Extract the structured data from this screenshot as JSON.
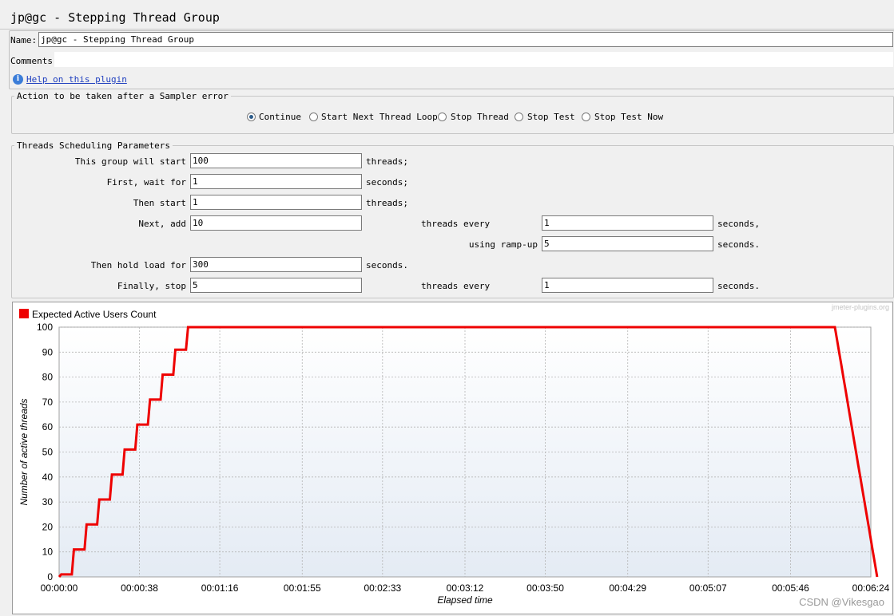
{
  "window": {
    "title": "jp@gc - Stepping Thread Group"
  },
  "form": {
    "name_label": "Name:",
    "name_value": "jp@gc - Stepping Thread Group",
    "comments_label": "Comments:",
    "comments_value": "",
    "help_link": "Help on this plugin"
  },
  "sampler_error": {
    "legend": "Action to be taken after a Sampler error",
    "options": [
      "Continue",
      "Start Next Thread Loop",
      "Stop Thread",
      "Stop Test",
      "Stop Test Now"
    ],
    "selected": "Continue"
  },
  "scheduling": {
    "legend": "Threads Scheduling Parameters",
    "row1": {
      "label": "This group will start",
      "value": "100",
      "unit": "threads;"
    },
    "row2": {
      "label": "First, wait for",
      "value": "1",
      "unit": "seconds;"
    },
    "row3": {
      "label": "Then start",
      "value": "1",
      "unit": "threads;"
    },
    "row4": {
      "label": "Next, add",
      "value": "10",
      "mid_label": "threads every",
      "value2": "1",
      "unit": "seconds,"
    },
    "row5": {
      "label": "using ramp-up",
      "value": "5",
      "unit": "seconds."
    },
    "row6": {
      "label": "Then hold load for",
      "value": "300",
      "unit": "seconds."
    },
    "row7": {
      "label": "Finally, stop",
      "value": "5",
      "mid_label": "threads every",
      "value2": "1",
      "unit": "seconds."
    }
  },
  "chart": {
    "watermark": "jmeter-plugins.org",
    "credit": "CSDN @Vikesgao"
  },
  "colors": {
    "series": "#ee0000",
    "accent": "#2b5b8a",
    "link": "#1f3fbf"
  },
  "chart_data": {
    "type": "line",
    "series": [
      {
        "name": "Expected Active Users Count",
        "x": [
          "00:00:00",
          "00:00:01",
          "00:00:02",
          "00:00:06",
          "00:00:07",
          "00:00:12",
          "00:00:13",
          "00:00:18",
          "00:00:19",
          "00:00:24",
          "00:00:25",
          "00:00:30",
          "00:00:31",
          "00:00:36",
          "00:00:37",
          "00:00:42",
          "00:00:43",
          "00:00:48",
          "00:00:49",
          "00:00:54",
          "00:00:55",
          "00:01:00",
          "00:01:01",
          "00:01:06",
          "00:01:07",
          "00:06:07",
          "00:06:08",
          "00:06:09",
          "00:06:10",
          "00:06:11",
          "00:06:12",
          "00:06:13",
          "00:06:14",
          "00:06:15",
          "00:06:16",
          "00:06:17",
          "00:06:18",
          "00:06:19",
          "00:06:20",
          "00:06:21",
          "00:06:22",
          "00:06:23",
          "00:06:24",
          "00:06:25",
          "00:06:26",
          "00:06:27"
        ],
        "y": [
          0,
          1,
          1,
          1,
          11,
          11,
          21,
          21,
          31,
          31,
          41,
          41,
          51,
          51,
          61,
          61,
          71,
          71,
          81,
          81,
          91,
          91,
          100,
          100,
          100,
          100,
          95,
          90,
          85,
          80,
          75,
          70,
          65,
          60,
          55,
          50,
          45,
          40,
          35,
          30,
          25,
          20,
          15,
          10,
          5,
          0
        ]
      }
    ],
    "xlabel": "Elapsed time",
    "ylabel": "Number of active threads",
    "x_ticks": [
      "00:00:00",
      "00:00:38",
      "00:01:16",
      "00:01:55",
      "00:02:33",
      "00:03:12",
      "00:03:50",
      "00:04:29",
      "00:05:07",
      "00:05:46",
      "00:06:24"
    ],
    "y_ticks": [
      0,
      10,
      20,
      30,
      40,
      50,
      60,
      70,
      80,
      90,
      100
    ],
    "ylim": [
      0,
      100
    ],
    "xlim_seconds": [
      0,
      384
    ],
    "grid": true,
    "legend_position": "top-left"
  }
}
